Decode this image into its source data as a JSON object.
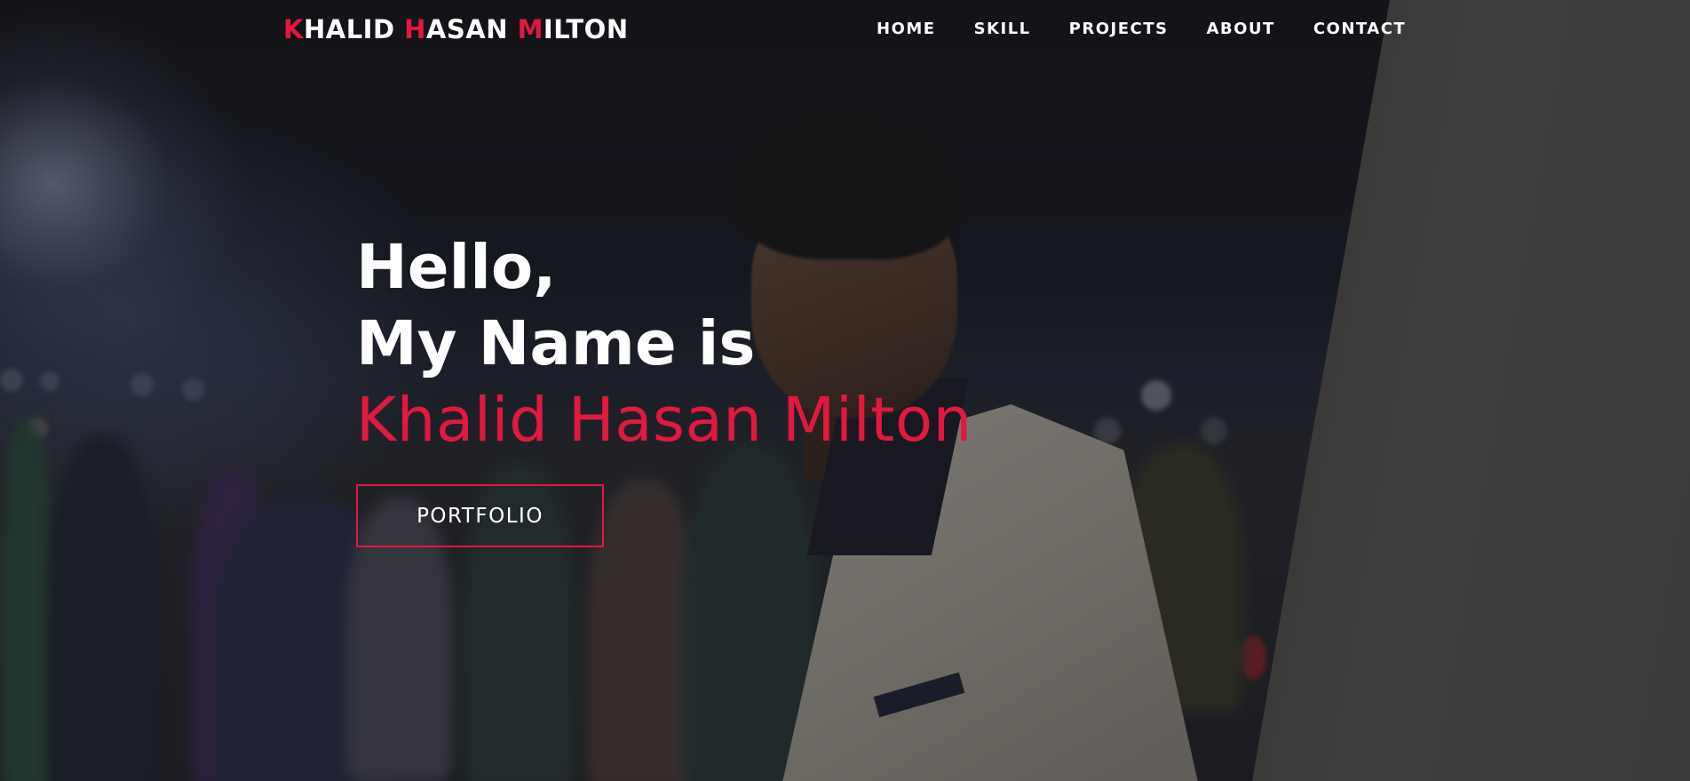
{
  "brand": {
    "parts": [
      {
        "text": "K",
        "accent": true
      },
      {
        "text": "HALID ",
        "accent": false
      },
      {
        "text": "H",
        "accent": true
      },
      {
        "text": "ASAN ",
        "accent": false
      },
      {
        "text": "M",
        "accent": true
      },
      {
        "text": "ILTON",
        "accent": false
      }
    ]
  },
  "nav": {
    "items": [
      {
        "label": "HOME"
      },
      {
        "label": "SKILL"
      },
      {
        "label": "PROJECTS"
      },
      {
        "label": "ABOUT"
      },
      {
        "label": "CONTACT"
      }
    ]
  },
  "hero": {
    "line1": "Hello,",
    "line2": "My Name is",
    "name": "Khalid Hasan Milton",
    "button_label": "PORTFOLIO"
  },
  "colors": {
    "accent": "#e0193e",
    "text": "#ffffff"
  }
}
